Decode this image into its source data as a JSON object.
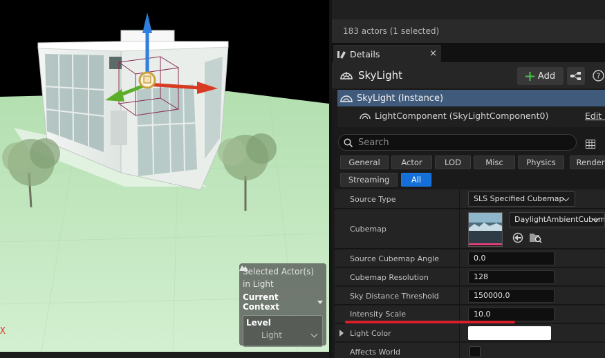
{
  "viewport": {
    "axis_label": "X",
    "context_panel": {
      "title": "Selected Actor(s) in Light",
      "current_context_label": "Current Context",
      "level_label": "Level",
      "level_value": "Light"
    },
    "colors": {
      "ground": "#c5e8c3",
      "gizmo_x": "#d83a22",
      "gizmo_y": "#5cae2a",
      "gizmo_z": "#2f7fe0"
    }
  },
  "outliner": {
    "status": "183 actors (1 selected)"
  },
  "details": {
    "tab_label": "Details",
    "close_glyph": "×",
    "actor_name": "SkyLight",
    "add_label": "Add",
    "components": {
      "instance": "SkyLight (Instance)",
      "child": "LightComponent (SkyLightComponent0)",
      "edit_link": "Edit i"
    },
    "search_placeholder": "Search",
    "filters": [
      "General",
      "Actor",
      "LOD",
      "Misc",
      "Physics",
      "Render",
      "Streaming",
      "All"
    ],
    "active_filter": "All",
    "properties": {
      "source_type": {
        "label": "Source Type",
        "value": "SLS Specified Cubemap"
      },
      "cubemap": {
        "label": "Cubemap",
        "value": "DaylightAmbientCubemap"
      },
      "source_cubemap_angle": {
        "label": "Source Cubemap Angle",
        "value": "0.0"
      },
      "cubemap_resolution": {
        "label": "Cubemap Resolution",
        "value": "128"
      },
      "sky_distance_threshold": {
        "label": "Sky Distance Threshold",
        "value": "150000.0"
      },
      "intensity_scale": {
        "label": "Intensity Scale",
        "value": "10.0"
      },
      "light_color": {
        "label": "Light Color",
        "value": "#ffffff"
      },
      "affects_world": {
        "label": "Affects World"
      }
    },
    "colors": {
      "accent": "#1470d8",
      "selected_row": "#3f5a7a",
      "add_icon": "#4cc34c",
      "highlight": "#d8202c"
    }
  }
}
